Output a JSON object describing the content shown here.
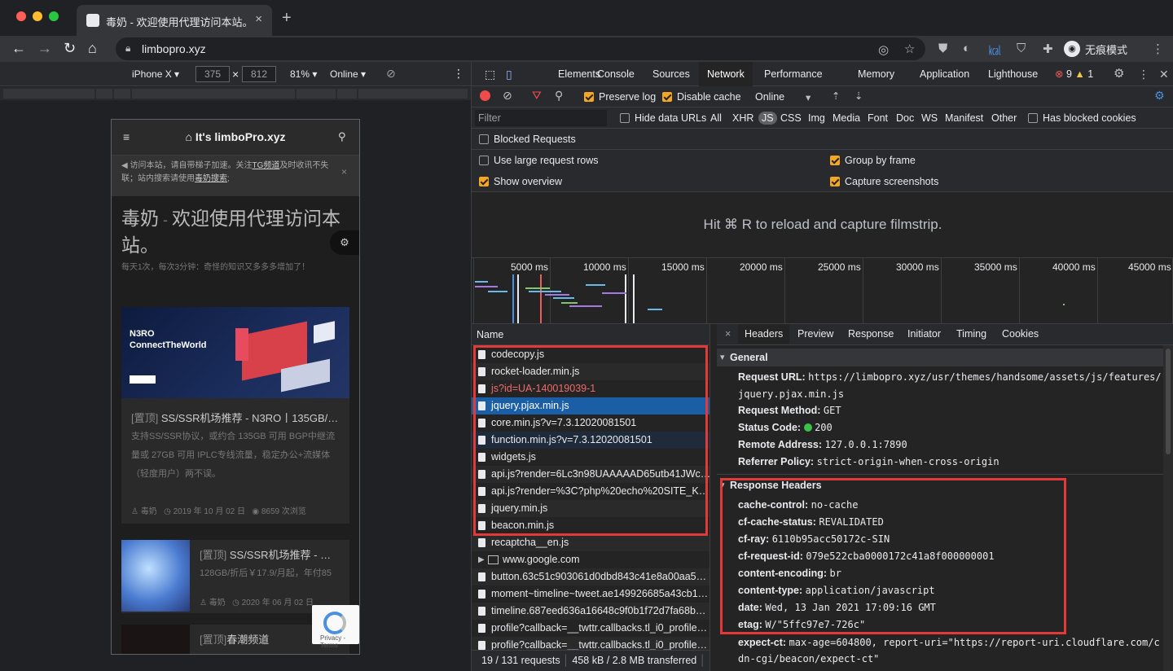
{
  "window": {
    "tab_title": "毒奶 - 欢迎使用代理访问本站。",
    "new_tab": "+",
    "tab_close": "×"
  },
  "toolbar": {
    "url": "limbopro.xyz",
    "profile_label": "无痕模式"
  },
  "device_bar": {
    "device": "iPhone X ▾",
    "width": "375",
    "times": "×",
    "height": "812",
    "zoom": "81% ▾",
    "throttle": "Online ▾"
  },
  "page": {
    "site_title": "It's limboPro.xyz",
    "notice": {
      "text1": "访问本站，请自带梯子加速。关注",
      "tg": "TG频道",
      "text2": "及时收讯不失联；站内搜索请使用",
      "search": "毒奶搜索",
      "text3": ";"
    },
    "hero_title": "毒奶",
    "hero_sep": " - ",
    "hero_rest": "欢迎使用代理访问本站。",
    "hero_sub": "每天1次，每次3分钟：奇怪的知识又多多多增加了！",
    "card1": {
      "banner1": "N3RO",
      "banner2": "ConnectTheWorld",
      "tag": "[置顶]",
      "title": " SS/SSR机场推荐 - N3RO丨135GB/…",
      "desc": "支持SS/SSR协议，或约合 135GB 可用 BGP中继流量或 27GB 可用 IPLC专线流量，稳定办公+流媒体（轻度用户）两不误。",
      "author": "毒奶",
      "date": "2019 年 10 月 02 日",
      "views": "8659 次浏览"
    },
    "card2": {
      "tag": "[置顶]",
      "title": " SS/SSR机场推荐 - …",
      "desc": "128GB/折后￥17.9/月起，年付85",
      "author": "毒奶",
      "date": "2020 年 06 月 02 日"
    },
    "card3": {
      "tag": "[置顶]",
      "title": "春潮频道"
    },
    "recaptcha": "Privacy - Terms"
  },
  "devtools": {
    "tabs": [
      "Elements",
      "Console",
      "Sources",
      "Network",
      "Performance",
      "Memory",
      "Application",
      "Lighthouse"
    ],
    "errors": "9",
    "warnings": "1",
    "preserve_log": "Preserve log",
    "disable_cache": "Disable cache",
    "throttle": "Online",
    "filter_placeholder": "Filter",
    "hide_data_urls": "Hide data URLs",
    "types": [
      "All",
      "XHR",
      "JS",
      "CSS",
      "Img",
      "Media",
      "Font",
      "Doc",
      "WS",
      "Manifest",
      "Other"
    ],
    "has_blocked_cookies": "Has blocked cookies",
    "blocked_requests": "Blocked Requests",
    "large_rows": "Use large request rows",
    "group_by_frame": "Group by frame",
    "show_overview": "Show overview",
    "capture_screenshots": "Capture screenshots",
    "film_msg": "Hit ⌘ R to reload and capture filmstrip.",
    "ticks": [
      "5000 ms",
      "10000 ms",
      "15000 ms",
      "20000 ms",
      "25000 ms",
      "30000 ms",
      "35000 ms",
      "40000 ms",
      "45000 ms"
    ],
    "name_header": "Name",
    "requests": [
      "codecopy.js",
      "rocket-loader.min.js",
      "js?id=UA-140019039-1",
      "jquery.pjax.min.js",
      "core.min.js?v=7.3.12020081501",
      "function.min.js?v=7.3.12020081501",
      "widgets.js",
      "api.js?render=6Lc3n98UAAAAAD65utb41JWcK…",
      "api.js?render=%3C?php%20echo%20SITE_KE…",
      "jquery.min.js",
      "beacon.min.js",
      "recaptcha__en.js",
      "www.google.com",
      "button.63c51c903061d0dbd843c41e8a00aa5a.js",
      "moment~timeline~tweet.ae149926685a43cb146…",
      "timeline.687eed636a16648c9f0b1f72d7fa68bd.js",
      "profile?callback=__twttr.callbacks.tl_i0_profile_l…",
      "profile?callback=__twttr.callbacks.tl_i0_profile_l…"
    ],
    "status": "19 / 131 requests",
    "transferred": "458 kB / 2.8 MB transferred",
    "detail_tabs": [
      "Headers",
      "Preview",
      "Response",
      "Initiator",
      "Timing",
      "Cookies"
    ],
    "general_title": "General",
    "general": [
      {
        "k": "Request URL:",
        "v": "https://limbopro.xyz/usr/themes/handsome/assets/js/features/"
      },
      {
        "k": "",
        "v": "jquery.pjax.min.js"
      },
      {
        "k": "Request Method:",
        "v": "GET"
      },
      {
        "k": "Status Code:",
        "v": "200"
      },
      {
        "k": "Remote Address:",
        "v": "127.0.0.1:7890"
      },
      {
        "k": "Referrer Policy:",
        "v": "strict-origin-when-cross-origin"
      }
    ],
    "response_title": "Response Headers",
    "response": [
      {
        "k": "cache-control:",
        "v": "no-cache"
      },
      {
        "k": "cf-cache-status:",
        "v": "REVALIDATED"
      },
      {
        "k": "cf-ray:",
        "v": "6110b95acc50172c-SIN"
      },
      {
        "k": "cf-request-id:",
        "v": "079e522cba0000172c41a8f000000001"
      },
      {
        "k": "content-encoding:",
        "v": "br"
      },
      {
        "k": "content-type:",
        "v": "application/javascript"
      },
      {
        "k": "date:",
        "v": "Wed, 13 Jan 2021 17:09:16 GMT"
      },
      {
        "k": "etag:",
        "v": "W/\"5ffc97e7-726c\""
      },
      {
        "k": "expect-ct:",
        "v": "max-age=604800, report-uri=\"https://report-uri.cloudflare.com/c"
      },
      {
        "k": "",
        "v": "dn-cgi/beacon/expect-ct\""
      }
    ]
  }
}
